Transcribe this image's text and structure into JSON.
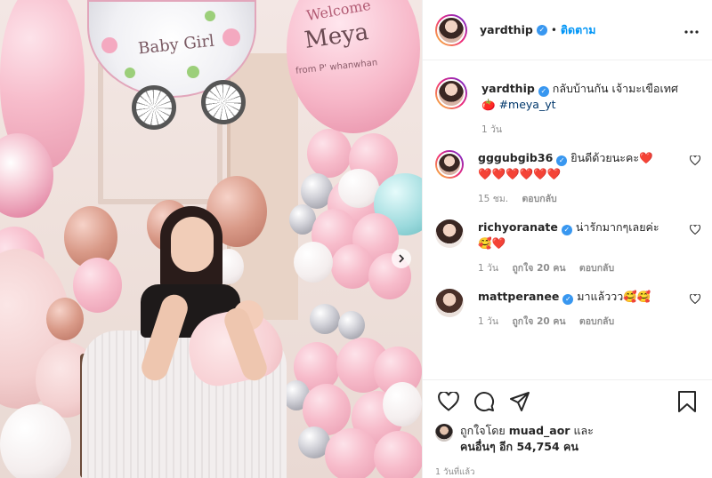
{
  "colors": {
    "accent": "#0095f6",
    "verified": "#3897f0",
    "heart": "#ed4956",
    "muted": "#8e8e8e"
  },
  "photo": {
    "carriage_text": "Baby Girl",
    "welcome_line1": "Welcome",
    "welcome_name": "Meya",
    "welcome_from": "from P' whanwhan"
  },
  "header": {
    "username": "yardthip",
    "separator": "•",
    "follow_label": "ติดตาม",
    "more_icon": "more-icon"
  },
  "caption": {
    "username": "yardthip",
    "text": "กลับบ้านกัน เจ้ามะเขือเทศ",
    "emoji": "🍅",
    "hashtag": "#meya_yt",
    "time": "1 วัน"
  },
  "comments": [
    {
      "username": "gggubgib36",
      "verified": true,
      "text": "ยินดีด้วยนะคะ❤️",
      "text2": "❤️❤️❤️❤️❤️❤️",
      "time": "15 ชม.",
      "likes": "",
      "reply": "ตอบกลับ"
    },
    {
      "username": "richyoranate",
      "verified": true,
      "text": "น่ารักมากๆเลยค่ะ",
      "text2": "🥰❤️",
      "time": "1 วัน",
      "likes": "ถูกใจ 20 คน",
      "reply": "ตอบกลับ"
    },
    {
      "username": "mattperanee",
      "verified": true,
      "text": "มาแล้ววว🥰🥰",
      "text2": "",
      "time": "1 วัน",
      "likes": "ถูกใจ 20 คน",
      "reply": "ตอบกลับ"
    }
  ],
  "footer": {
    "liked_by_prefix": "ถูกใจโดย",
    "liked_by_user": "muad_aor",
    "and": "และ",
    "others_label": "คนอื่นๆ อีก 54,754 คน",
    "timestamp": "1 วันที่แล้ว"
  },
  "icons": [
    "heart-icon",
    "comment-icon",
    "share-icon",
    "bookmark-icon",
    "next-arrow-icon",
    "verified-icon"
  ]
}
